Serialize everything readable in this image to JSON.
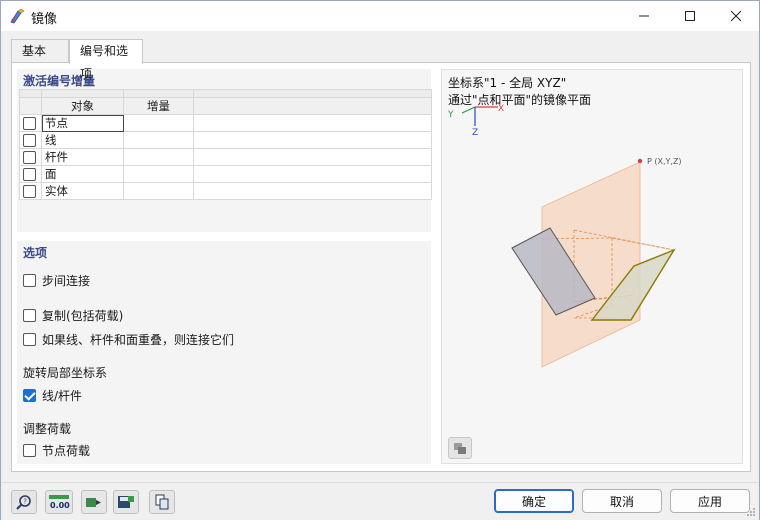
{
  "window": {
    "title": "镜像",
    "icon": "mirror-app-icon"
  },
  "tabs": [
    {
      "label": "基本",
      "active": false
    },
    {
      "label": "编号和选项",
      "active": true
    }
  ],
  "numbering": {
    "title": "激活编号增量",
    "columns": [
      "对象",
      "增量"
    ],
    "rows": [
      {
        "object": "节点",
        "increment": "",
        "checked": false
      },
      {
        "object": "线",
        "increment": "",
        "checked": false
      },
      {
        "object": "杆件",
        "increment": "",
        "checked": false
      },
      {
        "object": "面",
        "increment": "",
        "checked": false
      },
      {
        "object": "实体",
        "increment": "",
        "checked": false
      }
    ]
  },
  "options": {
    "title": "选项",
    "step_connect": {
      "label": "步间连接",
      "checked": false
    },
    "copy_with_loads": {
      "label": "复制(包括荷载)",
      "checked": false
    },
    "connect_overlap": {
      "label": "如果线、杆件和面重叠，则连接它们",
      "checked": false
    },
    "rotate_local_heading": "旋转局部坐标系",
    "lines_members": {
      "label": "线/杆件",
      "checked": true
    },
    "adjust_loads_heading": "调整荷载",
    "nodal_loads": {
      "label": "节点荷载",
      "checked": false
    }
  },
  "preview": {
    "line1": "坐标系\"1 - 全局 XYZ\"",
    "line2": "通过\"点和平面\"的镜像平面",
    "axis_x": "X",
    "axis_y": "Y",
    "axis_z": "Z",
    "point_label": "P (X,Y,Z)"
  },
  "buttons": {
    "ok": "确定",
    "cancel": "取消",
    "apply": "应用"
  },
  "colors": {
    "accent": "#1e6fcf",
    "panel_title": "#3b4a8a",
    "mirror_plane": "#f6c9a8",
    "mirrored_shape": "#c8b400"
  }
}
